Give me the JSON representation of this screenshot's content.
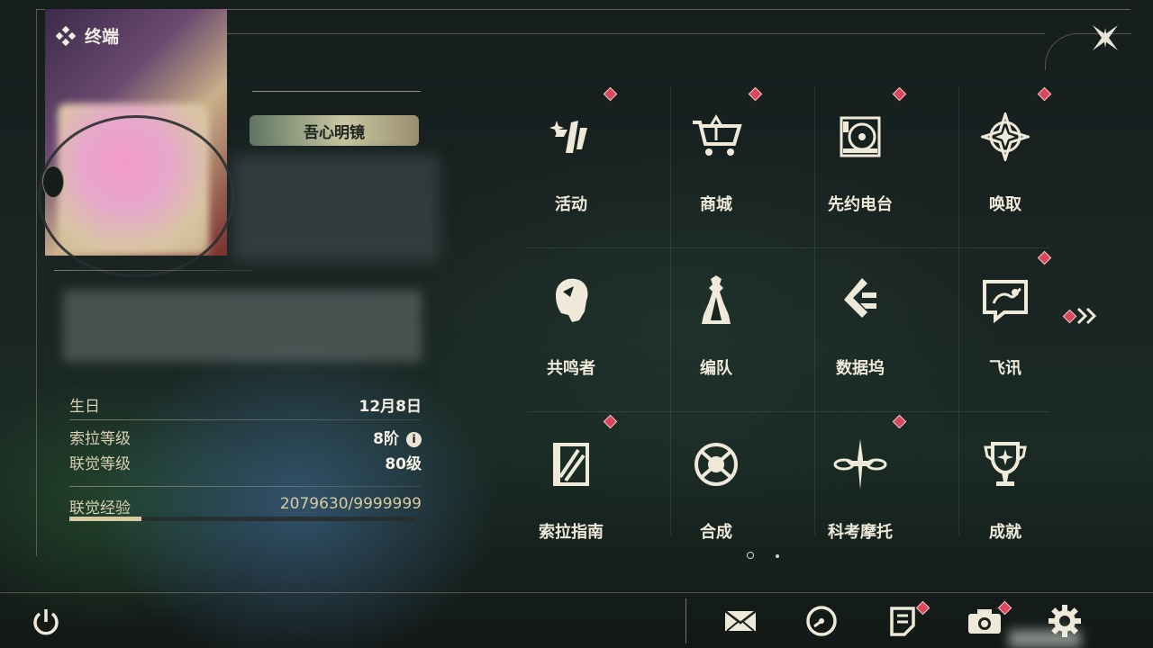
{
  "terminal": {
    "title": "终端"
  },
  "profile": {
    "name_plate": "吾心明镜",
    "fields": [
      {
        "label": "生日",
        "value": "12月8日"
      },
      {
        "label": "索拉等级",
        "value": "8阶"
      },
      {
        "label": "联觉等级",
        "value": "80级"
      }
    ],
    "exp": {
      "label": "联觉经验",
      "value": "2079630/9999999",
      "fraction": 0.208
    }
  },
  "menu": {
    "items": [
      {
        "label": "活动",
        "icon": "event-icon",
        "badge": true
      },
      {
        "label": "商城",
        "icon": "shop-cart-icon",
        "badge": true
      },
      {
        "label": "先约电台",
        "icon": "radio-vinyl-icon",
        "badge": true
      },
      {
        "label": "唤取",
        "icon": "convene-star-icon",
        "badge": true
      },
      {
        "label": "共鸣者",
        "icon": "character-portrait-icon",
        "badge": false
      },
      {
        "label": "编队",
        "icon": "chess-team-icon",
        "badge": false
      },
      {
        "label": "数据坞",
        "icon": "data-bank-icon",
        "badge": false
      },
      {
        "label": "飞讯",
        "icon": "message-bubble-icon",
        "badge": true
      },
      {
        "label": "索拉指南",
        "icon": "guidebook-icon",
        "badge": true
      },
      {
        "label": "合成",
        "icon": "synthesis-icon",
        "badge": false
      },
      {
        "label": "科考摩托",
        "icon": "motorcycle-icon",
        "badge": true
      },
      {
        "label": "成就",
        "icon": "trophy-icon",
        "badge": false
      }
    ],
    "page_count": 2,
    "active_page": 1
  },
  "bottom_bar": {
    "icons": [
      "mail-icon",
      "clock-icon",
      "notice-icon",
      "camera-icon",
      "settings-gear-icon"
    ]
  },
  "colors": {
    "accent": "#d8cba0",
    "badge": "#d8485a",
    "text": "#efe9da"
  }
}
